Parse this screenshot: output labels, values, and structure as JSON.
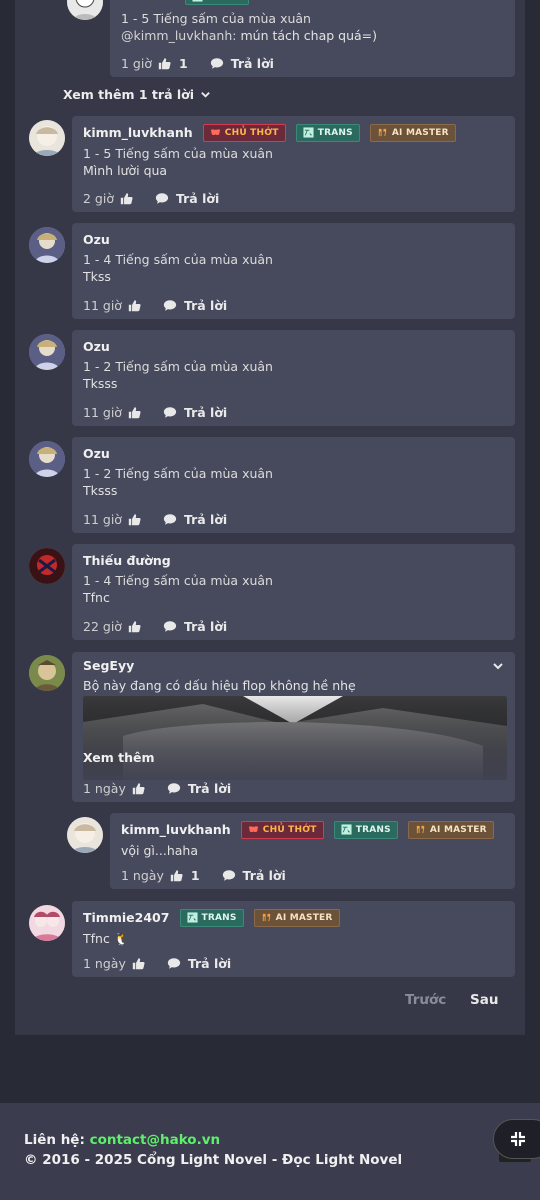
{
  "badges": {
    "owner": "CHỦ THỚT",
    "trans": "TRANS",
    "ai": "AI MASTER"
  },
  "icons": {
    "like": "thumbs-up-icon",
    "reply": "comment-bubble-icon",
    "expand": "chevron-down-icon",
    "collapse": "compress-icon"
  },
  "comments": [
    {
      "user": "",
      "chapter": "1 - 5 Tiếng sấm của mùa xuân",
      "mention": "@kimm_luvkhanh:",
      "text": " mún tách chap quá=)",
      "time": "1 giờ",
      "likes": "1",
      "reply": "Trả lời"
    },
    {
      "user": "kimm_luvkhanh",
      "chapter": "1 - 5 Tiếng sấm của mùa xuân",
      "text": "Mình lười qua",
      "time": "2 giờ",
      "likes": "",
      "reply": "Trả lời"
    },
    {
      "user": "Ozu",
      "chapter": "1 - 4 Tiếng sấm của mùa xuân",
      "text": "Tkss",
      "time": "11 giờ",
      "likes": "",
      "reply": "Trả lời"
    },
    {
      "user": "Ozu",
      "chapter": "1 - 2 Tiếng sấm của mùa xuân",
      "text": "Tksss",
      "time": "11 giờ",
      "likes": "",
      "reply": "Trả lời"
    },
    {
      "user": "Ozu",
      "chapter": "1 - 2 Tiếng sấm của mùa xuân",
      "text": "Tksss",
      "time": "11 giờ",
      "likes": "",
      "reply": "Trả lời"
    },
    {
      "user": "Thiếu đường",
      "chapter": "1 - 4 Tiếng sấm của mùa xuân",
      "text": "Tfnc",
      "time": "22 giờ",
      "likes": "",
      "reply": "Trả lời"
    },
    {
      "user": "SegEyy",
      "text": "Bộ này đang có dấu hiệu flop không hề nhẹ",
      "see_more": "Xem thêm",
      "time": "1 ngày",
      "likes": "",
      "reply": "Trả lời"
    },
    {
      "user": "kimm_luvkhanh",
      "text": "vội gì...haha",
      "time": "1 ngày",
      "likes": "1",
      "reply": "Trả lời"
    },
    {
      "user": "Timmie2407",
      "text": "Tfnc 🐧",
      "time": "1 ngày",
      "likes": "",
      "reply": "Trả lời"
    }
  ],
  "show_more_replies": "Xem thêm 1 trả lời",
  "pagination": {
    "prev": "Trước",
    "next": "Sau"
  },
  "footer": {
    "contact_label": "Liên hệ: ",
    "contact_email": "contact@hako.vn",
    "copyright": "© 2016 - 2025 Cổng Light Novel - Đọc Light Novel"
  },
  "colors": {
    "page_bg": "#282a36",
    "panel_bg": "#363848",
    "comment_bg": "#474a5c",
    "email": "#5ef06a",
    "owner_badge_text": "#ffb54d"
  }
}
